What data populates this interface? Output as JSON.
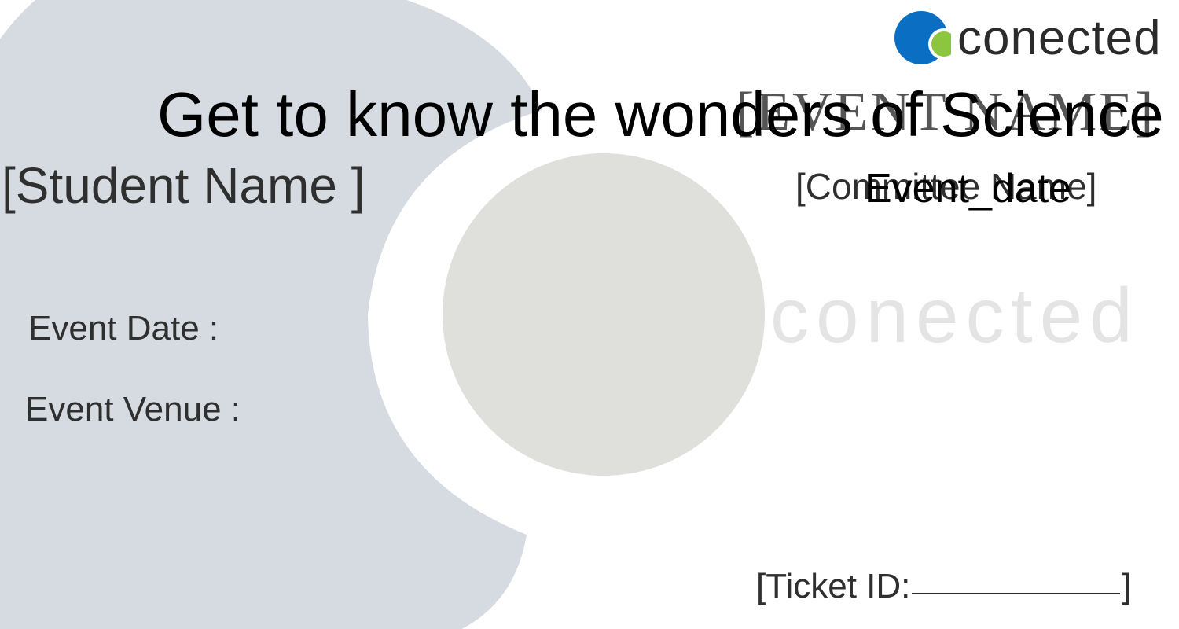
{
  "brand": {
    "name": "conected",
    "watermark": "conected",
    "colors": {
      "blue": "#0a6fc2",
      "green": "#8cc63f",
      "grey_shape": "#d5dbe0",
      "grey_circle": "#dfe0dc",
      "watermark_text": "#e4e4e4"
    }
  },
  "ticket": {
    "event_name_placeholder": "[EVENT NAME]",
    "headline": "Get to know the wonders of Science",
    "student_name_placeholder": "[Student Name ]",
    "committee_placeholder": "[Committee Name]",
    "event_date_value": "Event_date",
    "event_date_label": "Event Date :",
    "event_venue_label": "Event Venue :",
    "ticket_id_label": "[Ticket ID:",
    "ticket_id_close": "]"
  }
}
